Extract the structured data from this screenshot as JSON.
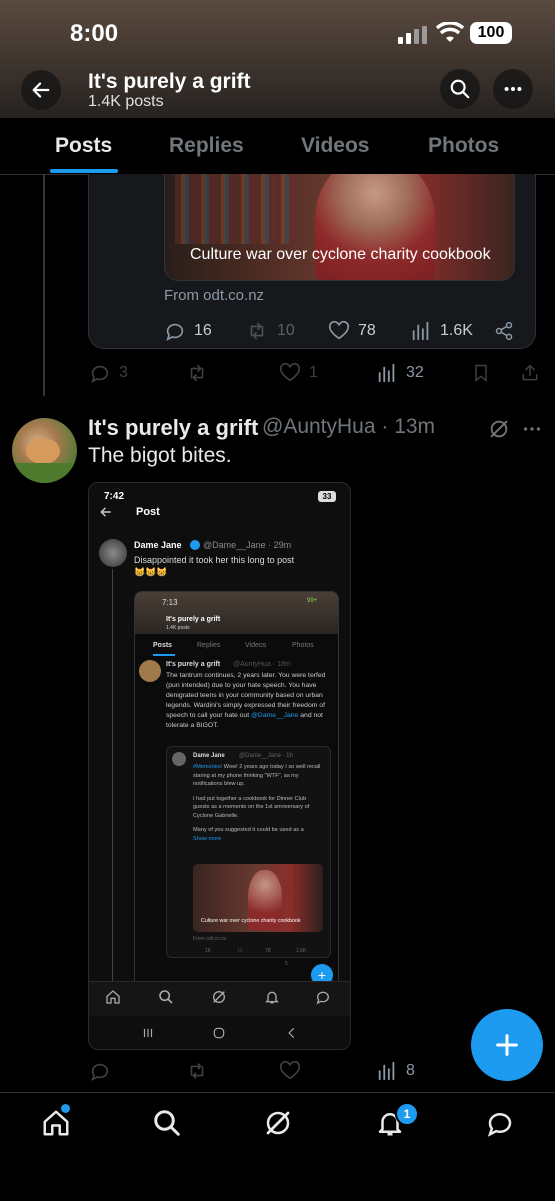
{
  "status": {
    "time": "8:00",
    "battery": "100"
  },
  "header": {
    "title": "It's purely a grift",
    "subtitle": "1.4K posts"
  },
  "tabs": [
    {
      "label": "Posts",
      "active": true
    },
    {
      "label": "Replies"
    },
    {
      "label": "Videos"
    },
    {
      "label": "Photos"
    }
  ],
  "quoted": {
    "caption": "Culture war over cyclone charity cookbook",
    "source": "From odt.co.nz",
    "metrics": {
      "replies": "16",
      "reposts": "10",
      "likes": "78",
      "views": "1.6K"
    }
  },
  "prev_actions": {
    "replies": "3",
    "likes": "1",
    "views": "32"
  },
  "post": {
    "author": "It's purely a grift",
    "handle": "@AuntyHua · 13m",
    "text": "The bigot bites.",
    "views": "8"
  },
  "screenshot": {
    "time": "7:42",
    "battery": "33",
    "header": "Post",
    "author": "Dame Jane",
    "handle": "@Dame__Jane · 29m",
    "text": "Disappointed it took her this long to post",
    "emojis": "😸😸😸",
    "inner": {
      "time": "7:13",
      "battery": "99+",
      "title": "It's purely a grift",
      "subtitle": "1.4K posts",
      "tabs": [
        "Posts",
        "Replies",
        "Videos",
        "Photos"
      ],
      "author": "It's purely a grift",
      "handle": "@AuntyHua · 18m",
      "text": "The tantrum continues, 2 years later. You were terfed (pun intended) due to your hate speech. You have denigrated teens in your community based on urban legends. Wardini's simply expressed their freedom of speech to call your hate out",
      "mention": "@Dame__Jane",
      "text_end": "and not tolerate a BIGOT.",
      "quote_author": "Dame Jane",
      "quote_handle": "@Dame__Jane · 1h",
      "quote_tag": "#Memories!",
      "quote_text1": "Wow! 2 years ago today I so well recall staring at my phone thinking \"WTF\", as my notifications blew up.",
      "quote_text2": "I had put together a cookbook for Dinner Club guests as a memento on the 1st anniversary of Cyclone Gabrielle.",
      "quote_text3": "Many of you suggested it could be used as a",
      "show_more": "Show more",
      "caption": "Culture war over cyclone charity cookbook",
      "source": "From odt.co.nz",
      "m_replies": "16",
      "m_reposts": "10",
      "m_likes": "78",
      "m_views": "1.6K",
      "m_views2": "5"
    }
  },
  "nav": {
    "notifications_badge": "1"
  },
  "colors": {
    "accent": "#1d9bf0",
    "muted": "#71767b",
    "bg": "#000000"
  }
}
